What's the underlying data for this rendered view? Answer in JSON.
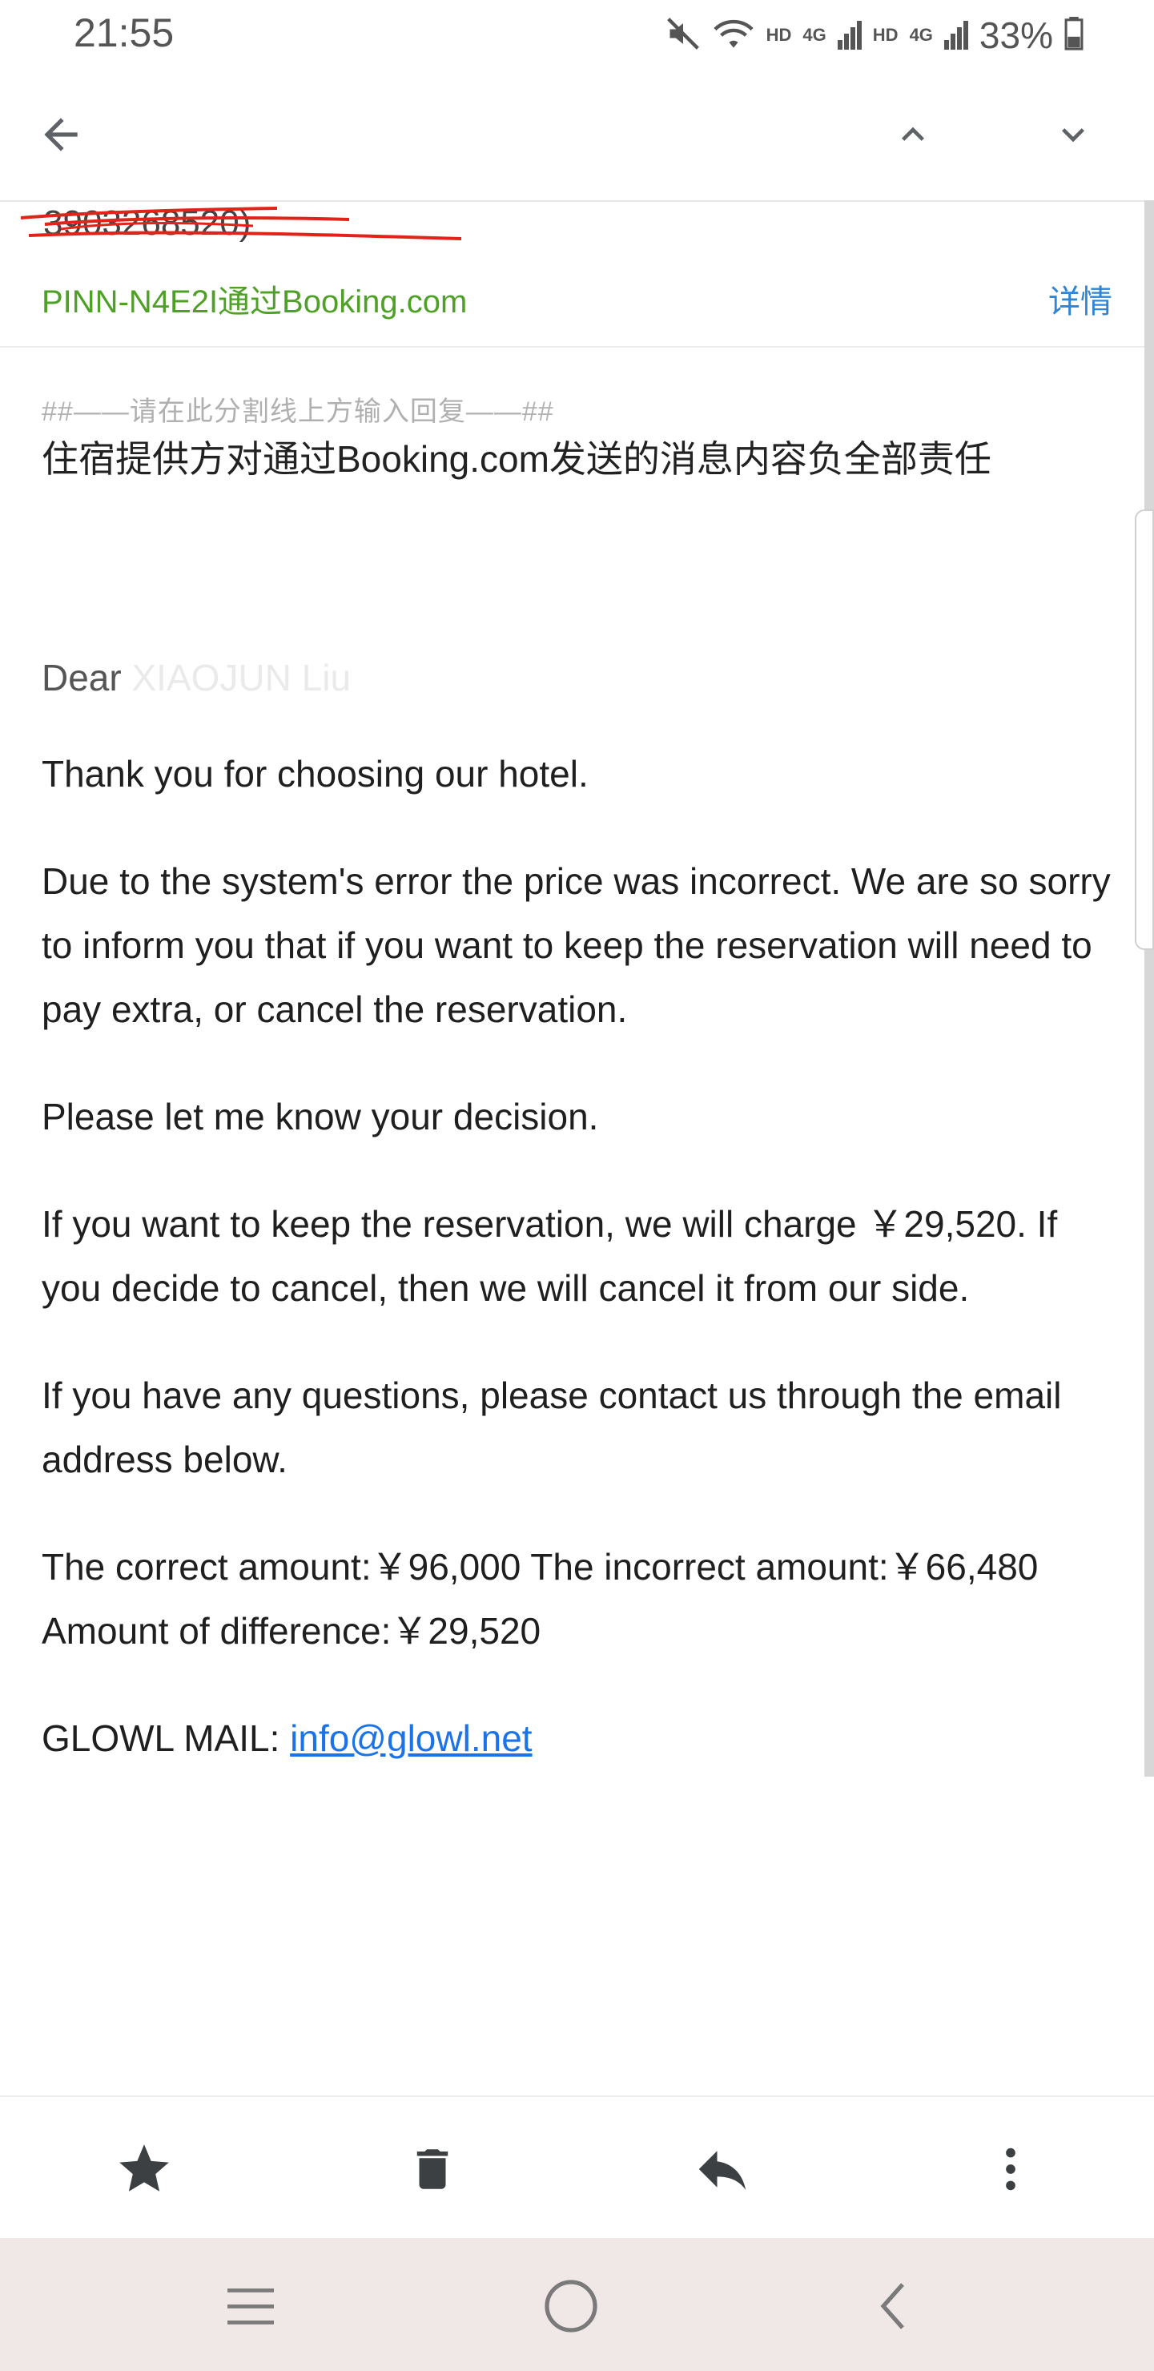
{
  "status_bar": {
    "time": "21:55",
    "hd1": "HD",
    "net1": "4G",
    "hd2": "HD",
    "net2": "4G",
    "battery": "33%",
    "icons": [
      "mute-icon",
      "wifi-icon",
      "signal-icon",
      "signal-icon",
      "battery-icon"
    ]
  },
  "toolbar": {
    "icons": [
      "back-arrow-icon",
      "chevron-up-icon",
      "chevron-down-icon"
    ]
  },
  "header": {
    "sender_fragment": "3903268520)",
    "sender_line": "PINN-N4E2I通过Booking.com",
    "details_label": "详情"
  },
  "message": {
    "reply_separator": "##——请在此分割线上方输入回复——##",
    "disclaimer": "住宿提供方对通过Booking.com发送的消息内容负全部责任",
    "greeting": "Dear",
    "greeting_name": "XIAOJUN Liu",
    "paragraphs": [
      "Thank you for choosing our hotel.",
      "Due to the system's error the price was incorrect. We are so sorry to inform you that if you want to keep the reservation will need to pay extra, or cancel the reservation.",
      "Please let me know your decision.",
      "If you want to keep the reservation, we will charge ￥29,520. If you decide to cancel, then we will cancel it from our side.",
      "If you have any questions, please contact us through the email address below.",
      "The correct amount:￥96,000 The incorrect amount:￥66,480 Amount of difference:￥29,520"
    ],
    "mail_label": "GLOWL MAIL: ",
    "mail_link": "info@glowl.net"
  },
  "actions": {
    "icons": [
      "star-icon",
      "trash-icon",
      "reply-icon",
      "more-vert-icon"
    ]
  },
  "nav": {
    "icons": [
      "recent-apps-icon",
      "home-icon",
      "back-nav-icon"
    ]
  }
}
